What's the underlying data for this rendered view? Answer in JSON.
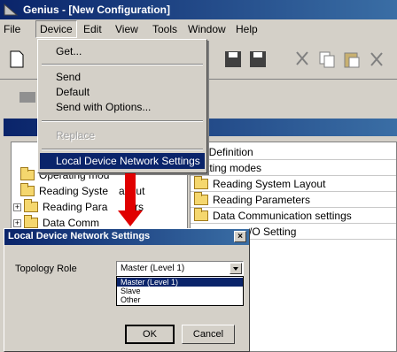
{
  "window": {
    "title": "Genius - [New Configuration]"
  },
  "menubar": [
    "File",
    "Device",
    "Edit",
    "View",
    "Tools",
    "Window",
    "Help"
  ],
  "device_menu": {
    "get": "Get...",
    "send": "Send",
    "default": "Default",
    "send_options": "Send with Options...",
    "replace": "Replace",
    "local_network": "Local Device Network Settings"
  },
  "tree": {
    "operating": "Operating mod",
    "reading_layout": "Reading Syste ayout",
    "reading_params": "Reading Para  ers",
    "data_comm": "Data Comm",
    "plus": "+"
  },
  "list": {
    "items": [
      "de Definition",
      "erating modes",
      "Reading System Layout",
      "Reading Parameters",
      "Data Communication settings",
      "/O Setting"
    ]
  },
  "dialog": {
    "title": "Local Device Network Settings",
    "close": "×",
    "label": "Topology Role",
    "selected": "Master (Level 1)",
    "options": [
      "Master (Level 1)",
      "Slave",
      "Other"
    ],
    "ok": "OK",
    "cancel": "Cancel"
  },
  "colors": {
    "accent": "#0a246a",
    "arrow": "#e00000"
  }
}
